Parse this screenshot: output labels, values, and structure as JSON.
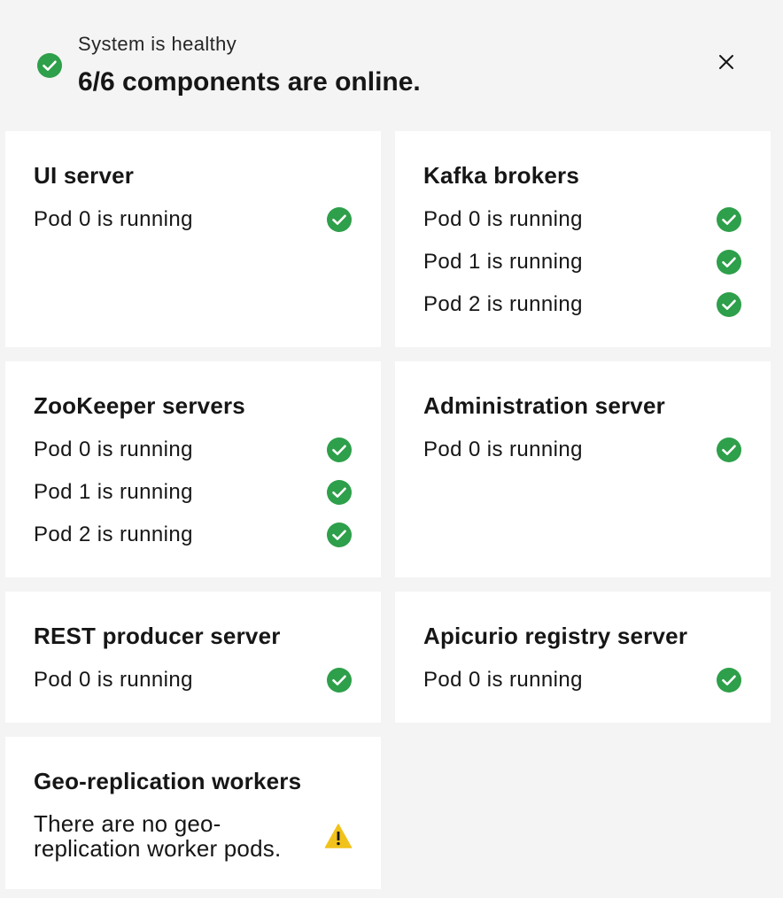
{
  "header": {
    "status_label": "System is healthy",
    "summary": "6/6 components are online.",
    "status_icon": "checkmark-filled-icon",
    "close_icon": "close-icon"
  },
  "colors": {
    "success": "#42be65",
    "success_dark": "#24a148",
    "warning": "#f1c21b",
    "card_bg": "#ffffff",
    "page_bg": "#f4f4f4"
  },
  "components": [
    {
      "title": "UI server",
      "pods": [
        "Pod 0 is running"
      ]
    },
    {
      "title": "Kafka brokers",
      "pods": [
        "Pod 0 is running",
        "Pod 1 is running",
        "Pod 2 is running"
      ]
    },
    {
      "title": "ZooKeeper servers",
      "pods": [
        "Pod 0 is running",
        "Pod 1 is running",
        "Pod 2 is running"
      ]
    },
    {
      "title": "Administration server",
      "pods": [
        "Pod 0 is running"
      ]
    },
    {
      "title": "REST producer server",
      "pods": [
        "Pod 0 is running"
      ]
    },
    {
      "title": "Apicurio registry server",
      "pods": [
        "Pod 0 is running"
      ]
    },
    {
      "title": "Geo-replication workers",
      "warning": "There are no geo-replication worker pods.",
      "warning_icon": "warning-triangle-icon"
    }
  ]
}
